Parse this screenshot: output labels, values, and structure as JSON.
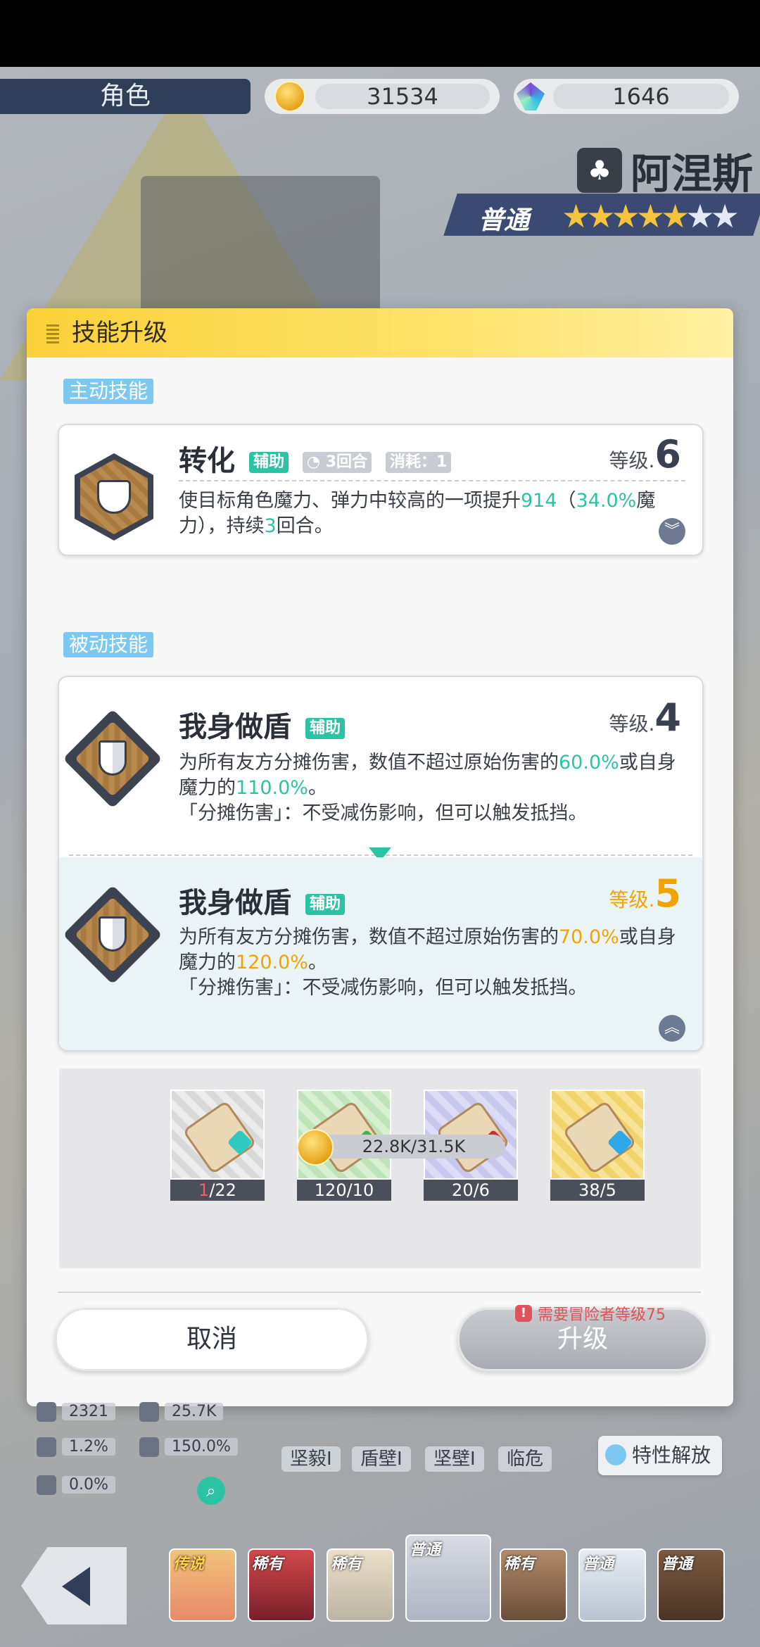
{
  "top_bar": {
    "role_tab": "角色",
    "coins": "31534",
    "gems": "1646"
  },
  "character": {
    "name": "阿涅斯",
    "rarity": "普通",
    "stars_filled": 5,
    "stars_total": 7
  },
  "dialog": {
    "title": "技能升级",
    "active_section": "主动技能",
    "passive_section": "被动技能",
    "active_skill": {
      "name": "转化",
      "tag": "辅助",
      "duration": "3回合",
      "cost": "消耗：1",
      "level_label": "等级.",
      "level": "6",
      "desc_a": "使目标角色魔力、弹力中较高的一项提升",
      "desc_v1": "914",
      "desc_b": "（",
      "desc_v2": "34.0%",
      "desc_c": "魔力），持续",
      "desc_v3": "3",
      "desc_d": "回合。"
    },
    "passive_current": {
      "name": "我身做盾",
      "tag": "辅助",
      "level_label": "等级.",
      "level": "4",
      "desc_a": "为所有友方分摊伤害，数值不超过原始伤害的",
      "desc_v1": "60.0%",
      "desc_b": "或自身魔力的",
      "desc_v2": "110.0%",
      "desc_c": "。",
      "desc_line2": "「分摊伤害」：不受减伤影响，但可以触发抵挡。"
    },
    "passive_next": {
      "name": "我身做盾",
      "tag": "辅助",
      "level_label": "等级.",
      "level": "5",
      "desc_a": "为所有友方分摊伤害，数值不超过原始伤害的",
      "desc_v1": "70.0%",
      "desc_b": "或自身魔力的",
      "desc_v2": "120.0%",
      "desc_c": "。",
      "desc_line2": "「分摊伤害」：不受减伤影响，但可以触发抵挡。"
    },
    "materials": [
      {
        "count_have": "1",
        "count_rest": "/22",
        "insufficient": true,
        "gem_color": "#2ec9c0"
      },
      {
        "count_have": "120/10",
        "count_rest": "",
        "insufficient": false,
        "gem_color": "#3cb44a"
      },
      {
        "count_have": "20/6",
        "count_rest": "",
        "insufficient": false,
        "gem_color": "#d8283c"
      },
      {
        "count_have": "38/5",
        "count_rest": "",
        "insufficient": false,
        "gem_color": "#2ea8e8"
      }
    ],
    "gold_cost": "22.8K/31.5K",
    "cancel_label": "取消",
    "upgrade_label": "升级",
    "requirement": "需要冒险者等级75"
  },
  "stats": {
    "s1": "2321",
    "s2": "25.7K",
    "s3": "1.2%",
    "s4": "150.0%",
    "s5": "0.0%"
  },
  "traits": [
    "坚毅I",
    "盾壁I",
    "坚壁I",
    "临危"
  ],
  "trait_unlock_label": "特性解放",
  "roster": [
    "传说",
    "稀有",
    "稀有",
    "普通",
    "稀有",
    "普通",
    "普通"
  ],
  "colors": {
    "accent_teal": "#2cc3a4",
    "accent_orange": "#f0a400",
    "header_yellow": "#fbd13a",
    "section_blue": "#7cc8f0"
  }
}
